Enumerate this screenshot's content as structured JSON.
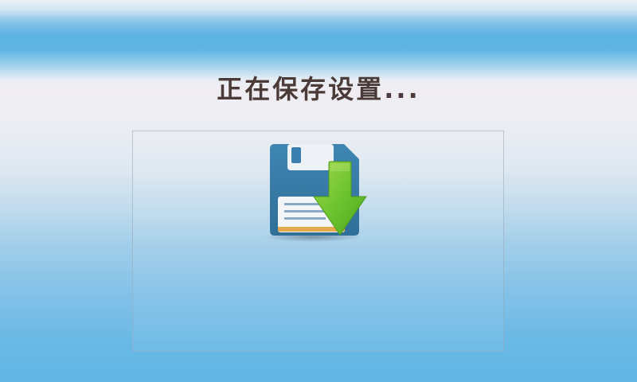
{
  "dialog": {
    "title": "正在保存设置...",
    "icon": "save-download-icon"
  }
}
